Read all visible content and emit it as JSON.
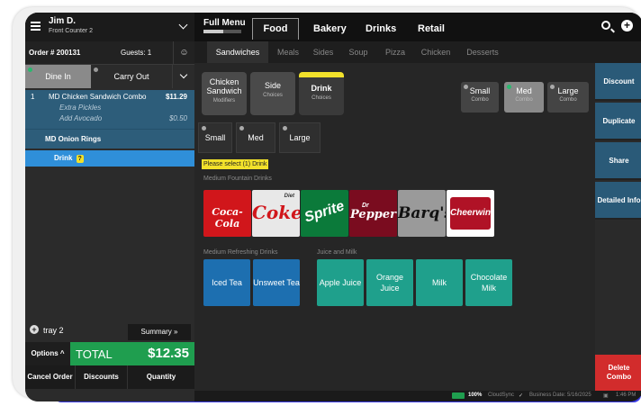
{
  "colors": {
    "accent_blue": "#2f8fd9",
    "order_item_bg": "#2d5d7a",
    "total_green": "#1f9e4f",
    "delete_red": "#d22c2c",
    "prompt_yellow": "#f2e12b",
    "tea_blue": "#1d6fb0",
    "juice_teal": "#1fa08c"
  },
  "header": {
    "user_name": "Jim D.",
    "user_station": "Front Counter 2",
    "menu_label": "Full Menu"
  },
  "order": {
    "number": "Order # 200131",
    "guests": "Guests: 1",
    "order_types": [
      "Dine In",
      "Carry Out"
    ],
    "items": [
      {
        "qty": "1",
        "name": "MD Chicken Sandwich Combo",
        "price": "$11.29",
        "modifiers": [
          {
            "name": "Extra Pickles",
            "price": ""
          },
          {
            "name": "Add Avocado",
            "price": "$0.50"
          }
        ]
      }
    ],
    "sub_item": "MD Onion Rings",
    "pending_item": "Drink",
    "pending_badge": "?",
    "tray_label": "tray 2",
    "summary_label": "Summary",
    "options_label": "Options",
    "total_label": "TOTAL",
    "total_value": "$12.35",
    "actions": [
      "Cancel Order",
      "Discounts",
      "Quantity"
    ]
  },
  "categories": [
    "Food",
    "Bakery",
    "Drinks",
    "Retail"
  ],
  "subcategories": [
    "Sandwiches",
    "Meals",
    "Sides",
    "Soup",
    "Pizza",
    "Chicken",
    "Desserts"
  ],
  "modifier_groups": [
    {
      "title": "Chicken Sandwich",
      "sub": "Modifiers"
    },
    {
      "title": "Side",
      "sub": "Choices"
    },
    {
      "title": "Drink",
      "sub": "Choices"
    }
  ],
  "combo_sizes": [
    {
      "title": "Small",
      "sub": "Combo"
    },
    {
      "title": "Med",
      "sub": "Combo"
    },
    {
      "title": "Large",
      "sub": "Combo"
    }
  ],
  "drink_sizes": [
    "Small",
    "Med",
    "Large"
  ],
  "prompt": "Please select (1) Drink",
  "sections": {
    "fountain": "Medium Fountain Drinks",
    "refreshing": "Medium Refreshing Drinks",
    "juice_milk": "Juice and Milk"
  },
  "fountain_logos": [
    {
      "brand": "Coca-Cola",
      "icon": "coca-cola-logo"
    },
    {
      "brand": "Coke",
      "icon": "diet-coke-logo"
    },
    {
      "brand": "Sprite",
      "icon": "sprite-logo"
    },
    {
      "brand": "Dr Pepper",
      "icon": "dr-pepper-logo"
    },
    {
      "brand": "Barq's",
      "icon": "barqs-logo"
    },
    {
      "brand": "Cheerwine",
      "icon": "cheerwine-logo"
    }
  ],
  "refreshing_drinks": [
    "Iced Tea",
    "Unsweet Tea"
  ],
  "juice_milk_drinks": [
    "Apple Juice",
    "Orange Juice",
    "Milk",
    "Chocolate Milk"
  ],
  "side_actions": [
    "Discount",
    "Duplicate",
    "Share",
    "Detailed Info"
  ],
  "delete_label": "Delete Combo",
  "status": {
    "battery": "100%",
    "sync": "CloudSync",
    "business_date": "Business Date: 5/16/2025",
    "time": "1:46 PM"
  }
}
